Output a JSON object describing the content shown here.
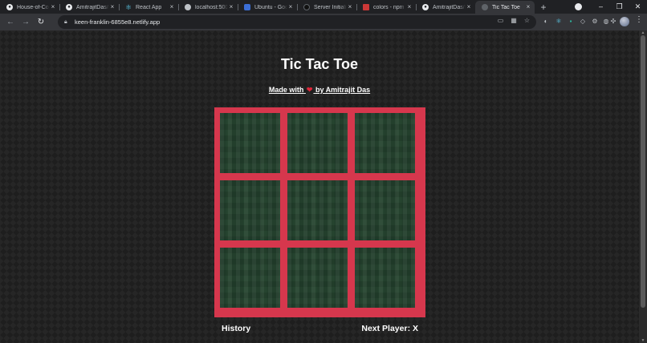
{
  "browser": {
    "tabs": [
      {
        "title": "House-of-Co",
        "icon": "github-icon",
        "active": false
      },
      {
        "title": "AmitrajitDas/t",
        "icon": "github-icon",
        "active": false
      },
      {
        "title": "React App",
        "icon": "react-icon",
        "active": false
      },
      {
        "title": "localhost:5000",
        "icon": "globe-icon",
        "active": false
      },
      {
        "title": "Ubuntu - Goo",
        "icon": "ubuntu-icon",
        "active": false
      },
      {
        "title": "Server Initializ",
        "icon": "server-icon",
        "active": false
      },
      {
        "title": "colors - npm",
        "icon": "npm-icon",
        "active": false
      },
      {
        "title": "AmitrajitDas/t",
        "icon": "github-icon",
        "active": false
      },
      {
        "title": "Tic Tac Toe",
        "icon": "globe-icon",
        "active": true
      }
    ],
    "new_tab_label": "+",
    "url": "keen-franklin-6855e8.netlify.app",
    "colors": {
      "tab_strip": "#202124",
      "toolbar": "#35363a"
    }
  },
  "page": {
    "title": "Tic Tac Toe",
    "credit_prefix": "Made with",
    "credit_heart": "❤",
    "credit_suffix": "by Amitrajit Das",
    "board": [
      "",
      "",
      "",
      "",
      "",
      "",
      "",
      "",
      ""
    ],
    "history_label": "History",
    "next_player_label": "Next Player: X",
    "colors": {
      "background": "#1e1e1e",
      "board_frame": "#d6374d",
      "cell": "#26442f",
      "text": "#ffffff"
    }
  }
}
